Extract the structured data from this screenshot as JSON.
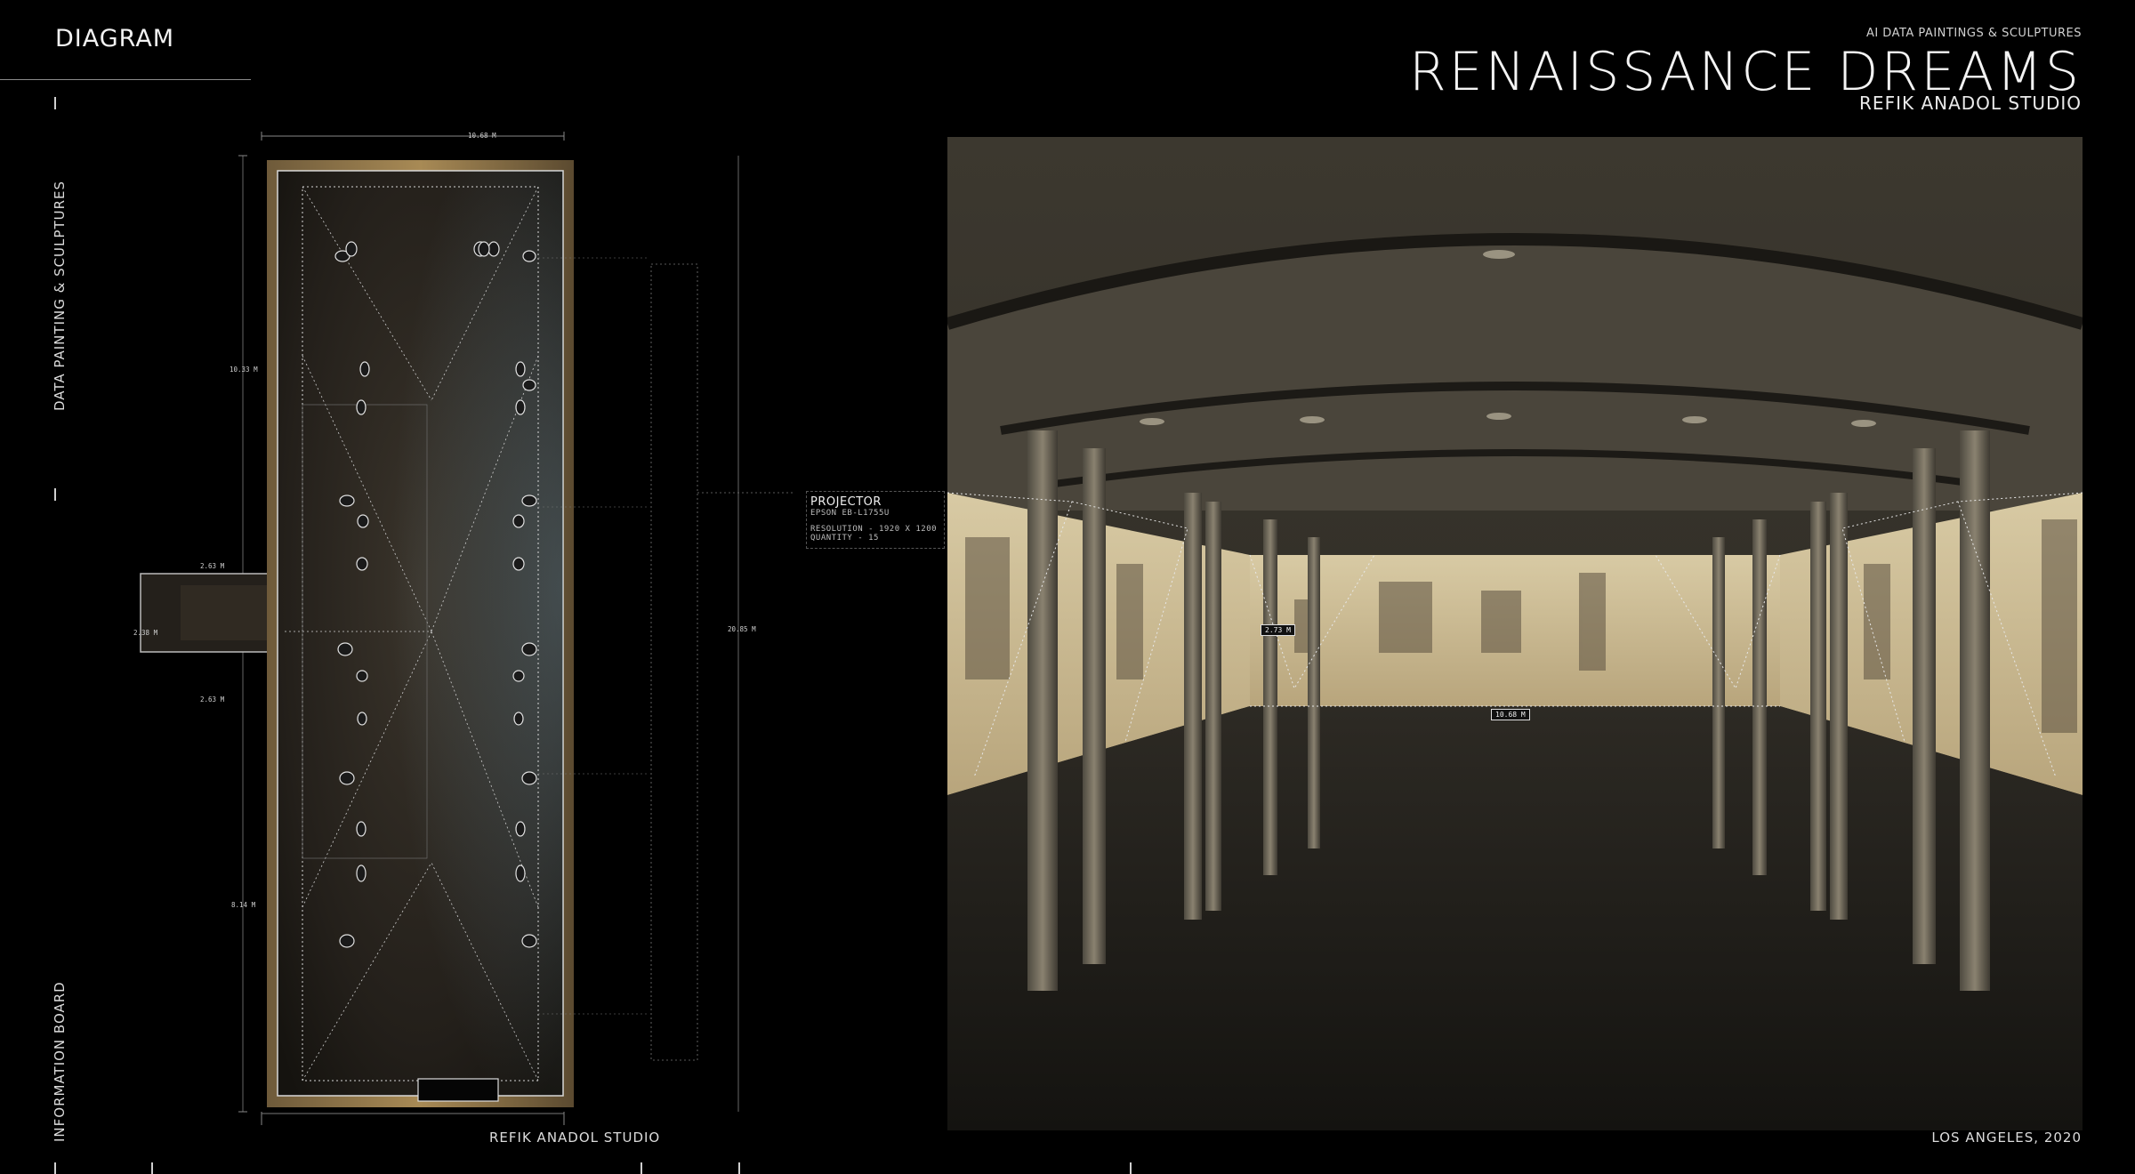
{
  "header": {
    "section_title": "DIAGRAM",
    "subtitle": "AI DATA PAINTINGS & SCULPTURES",
    "title": "RENAISSANCE DREAMS",
    "studio": "REFIK ANADOL STUDIO"
  },
  "side_labels": {
    "top": "DATA PAINTING & SCULPTURES",
    "bottom": "INFORMATION BOARD"
  },
  "footer": {
    "left": "REFIK ANADOL STUDIO",
    "right": "LOS ANGELES, 2020"
  },
  "plan": {
    "dimensions": {
      "width_top": "10.68 M",
      "upper_height": "10.33 M",
      "lower_height": "8.14 M",
      "total_height": "20.85 M",
      "annex_top": "2.63 M",
      "annex_height": "2.38 M",
      "annex_bottom": "2.63 M"
    },
    "projector": {
      "title": "PROJECTOR",
      "model": "EPSON EB-L1755U",
      "resolution": "RESOLUTION - 1920 X 1200",
      "quantity": "QUANTITY - 15"
    }
  },
  "render": {
    "tags": {
      "height": "2.73 M",
      "width": "10.68 M"
    }
  },
  "colors": {
    "background": "#000000",
    "floor_dark": "#2a2620",
    "wall_warm": "#b8a37a",
    "ceiling": "#4a453b"
  }
}
